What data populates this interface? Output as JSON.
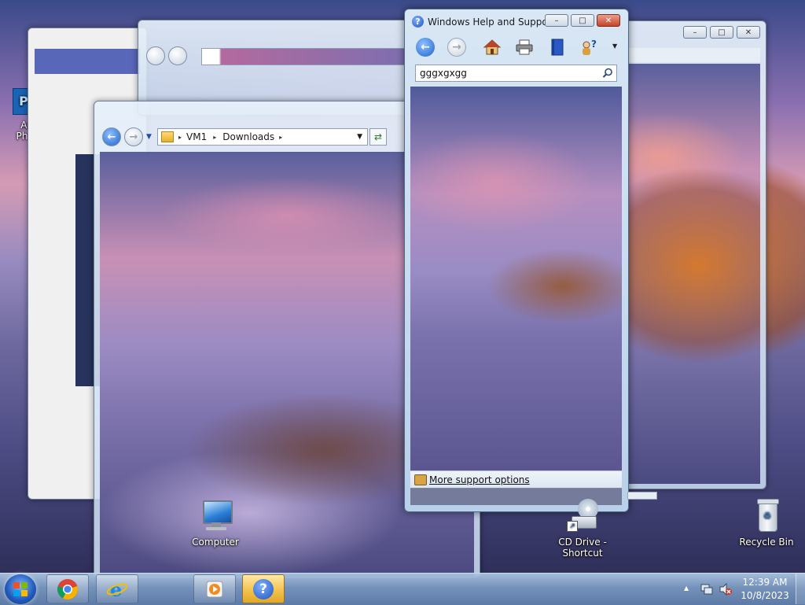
{
  "help_window": {
    "title": "Windows Help and Support",
    "search_value": "gggxgxgg",
    "footer_link": "More support options",
    "caption": {
      "minimize": "–",
      "maximize": "□",
      "close": "✕"
    }
  },
  "explorer_window": {
    "breadcrumb": [
      "VM1",
      "Downloads"
    ],
    "separator": "▸"
  },
  "desktop": {
    "icons": [
      {
        "label": "Computer"
      },
      {
        "label_line1": "CD Drive -",
        "label_line2": "Shortcut"
      },
      {
        "label": "Recycle Bin"
      },
      {
        "label_line1": "Ad",
        "label_line2": "Phot"
      }
    ]
  },
  "taskbar": {
    "clock_time": "12:39 AM",
    "clock_date": "10/8/2023",
    "tray_up_arrow": "▲"
  },
  "colors": {
    "accent_blue": "#1e63c9",
    "close_red": "#c6432a",
    "active_task": "#f3c250"
  }
}
